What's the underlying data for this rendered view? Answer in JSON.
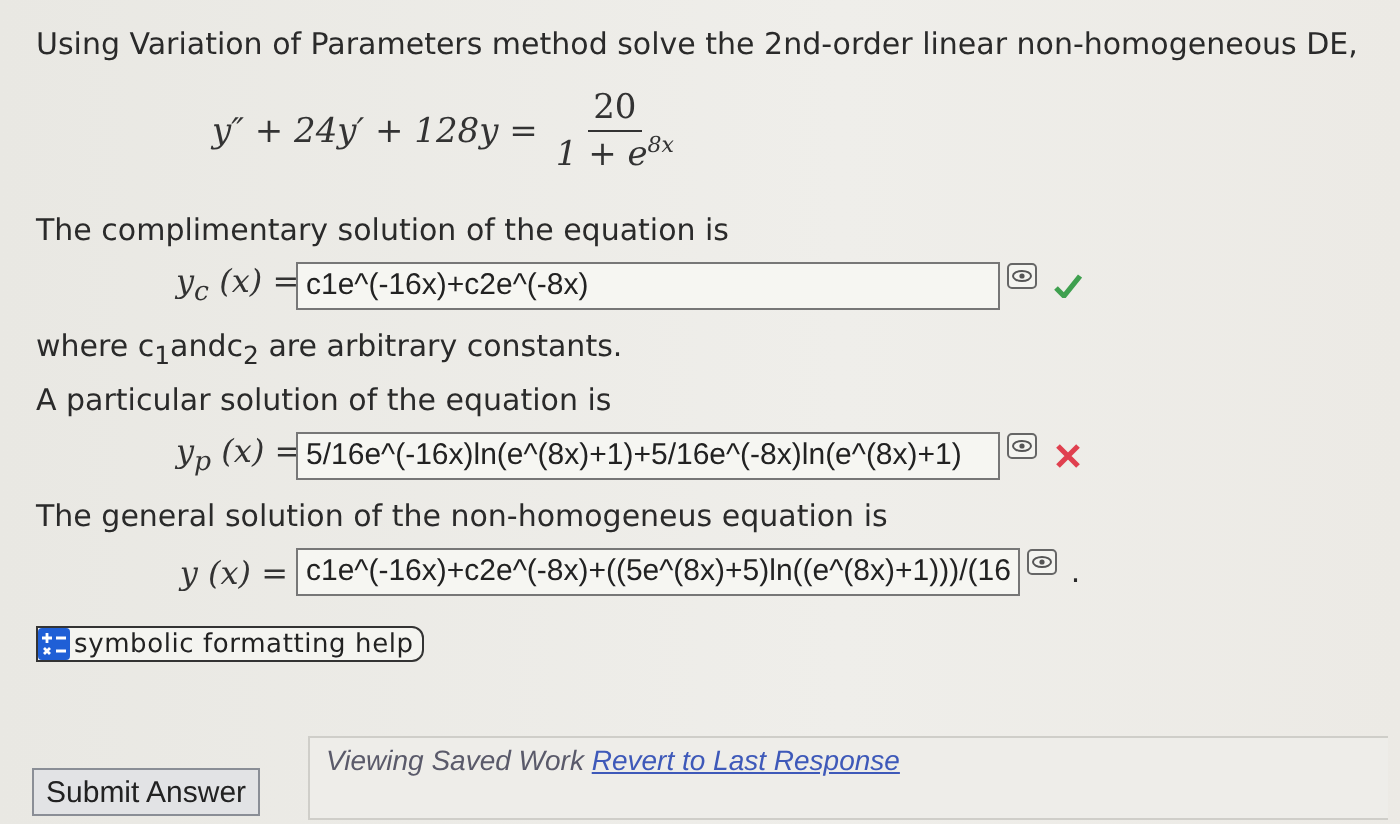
{
  "question": "Using Variation of Parameters method solve the 2nd-order linear non-homogeneous DE,",
  "equation": {
    "lhs": "y″ + 24y′ + 128y =",
    "numerator": "20",
    "denominator": "1 + e$^{8x}$"
  },
  "lines": [
    {
      "kind": "text",
      "text": "The complimentary solution of the equation is"
    },
    {
      "kind": "answer",
      "label": "y$_{c}$ (x) =",
      "value": "c1e^(-16x)+c2e^(-8x)",
      "correct": true
    },
    {
      "kind": "text",
      "text": "where c$_{1}$andc$_{2}$ are arbitrary constants."
    },
    {
      "kind": "text",
      "text": "A particular solution of the equation is"
    },
    {
      "kind": "answer",
      "label": "y$_{p}$ (x) =",
      "value": "5/16e^(-16x)ln(e^(8x)+1)+5/16e^(-8x)ln(e^(8x)+1)",
      "correct": false
    },
    {
      "kind": "text",
      "text": "The general solution of the non-homogeneus equation is"
    },
    {
      "kind": "answer",
      "label": "y (x) =",
      "value": "c1e^(-16x)+c2e^(-8x)+((5e^(8x)+5)ln((e^(8x)+1)))/(16",
      "suffix": "."
    }
  ],
  "help": {
    "label": "symbolic formatting help"
  },
  "footer": {
    "submit": "Submit Answer",
    "saved_note": "Viewing Saved Work",
    "revert_link": "Revert to Last Response"
  }
}
